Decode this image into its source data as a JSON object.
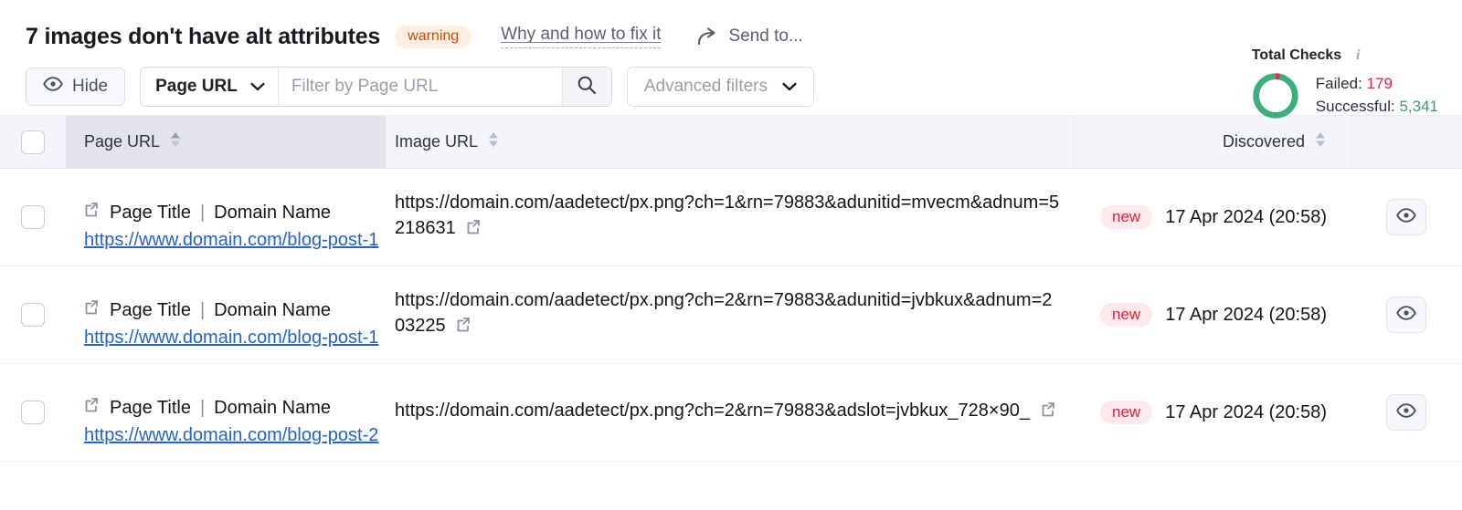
{
  "header": {
    "title": "7 images don't have alt attributes",
    "badge": "warning",
    "fix_link": "Why and how to fix it",
    "send_to": "Send to...",
    "send_icon": "share-arrow-icon"
  },
  "total_checks": {
    "label": "Total Checks",
    "info_icon": "info-icon",
    "failed_label": "Failed:",
    "failed_value": "179",
    "successful_label": "Successful:",
    "successful_value": "5,341",
    "failed_color": "#e4203a",
    "successful_color": "#2f9e6f",
    "donut_failed_pct": 3.2
  },
  "toolbar": {
    "hide_label": "Hide",
    "hide_icon": "eye-icon",
    "filter_field": "Page URL",
    "filter_placeholder": "Filter by Page URL",
    "filter_value": "",
    "search_icon": "search-icon",
    "advanced_filters_label": "Advanced filters",
    "chevron_icon": "chevron-down-icon"
  },
  "table": {
    "columns": [
      {
        "key": "page_url",
        "label": "Page URL",
        "sortable": true
      },
      {
        "key": "image_url",
        "label": "Image URL",
        "sortable": true
      },
      {
        "key": "discovered",
        "label": "Discovered",
        "sortable": true
      }
    ],
    "rows": [
      {
        "page_title": "Page Title",
        "page_domain": "Domain Name",
        "page_url": "https://www.domain.com/blog-post-1",
        "image_url": "https://domain.com/aadetect/px.png?ch=1&rn=79883&adunitid=mvecm&adnum=5218631",
        "badge": "new",
        "discovered": "17 Apr 2024 (20:58)"
      },
      {
        "page_title": "Page Title",
        "page_domain": "Domain Name",
        "page_url": "https://www.domain.com/blog-post-1",
        "image_url": "https://domain.com/aadetect/px.png?ch=2&rn=79883&adunitid=jvbkux&adnum=203225",
        "badge": "new",
        "discovered": "17 Apr 2024 (20:58)"
      },
      {
        "page_title": "Page Title",
        "page_domain": "Domain Name",
        "page_url": "https://www.domain.com/blog-post-2",
        "image_url": "https://domain.com/aadetect/px.png?ch=2&rn=79883&adslot=jvbkux_728×90_",
        "badge": "new",
        "discovered": "17 Apr 2024 (20:58)"
      }
    ],
    "title_separator": "|"
  }
}
